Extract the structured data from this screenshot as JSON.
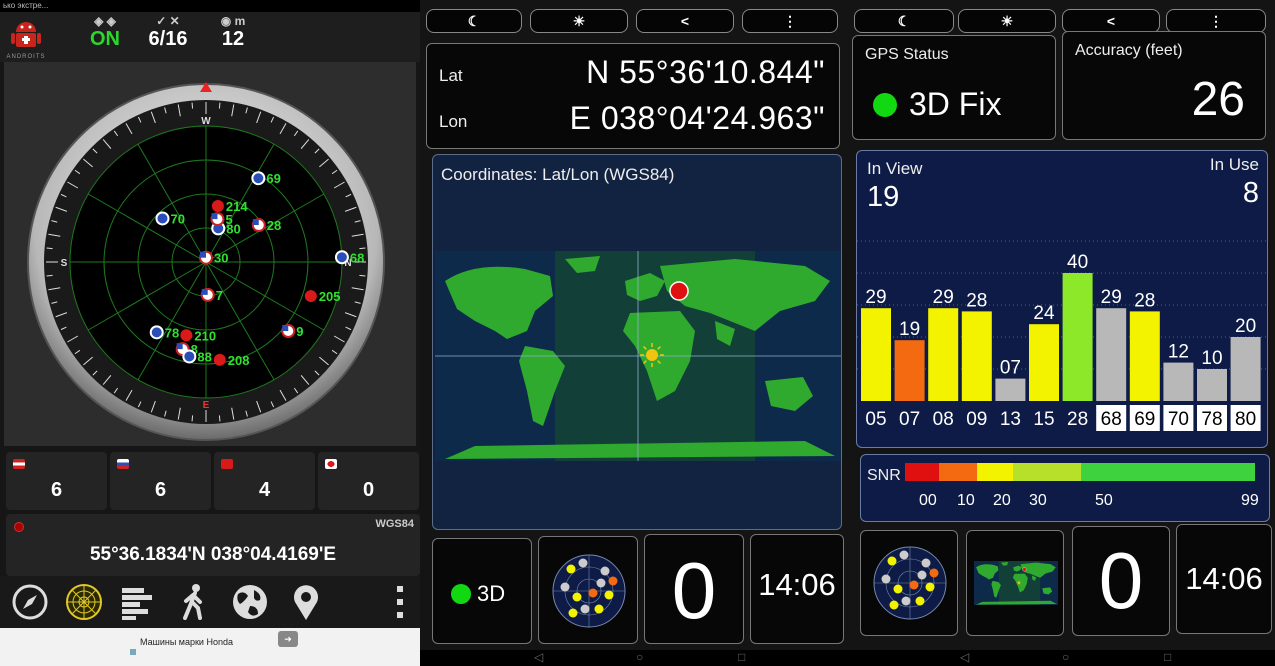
{
  "left_app": {
    "status_text": "ько экстре...",
    "logo_text": "ANDROITS",
    "status": {
      "fix_label": "ON",
      "sats_label": "6/16",
      "accuracy_unit": "m",
      "accuracy_value": "12"
    },
    "compass": {
      "bearings": [
        "W",
        "N",
        "E",
        "S"
      ],
      "sats": [
        {
          "id": "80",
          "az": 20,
          "el": 70,
          "flag": "ru"
        },
        {
          "id": "5",
          "az": 15,
          "el": 64,
          "flag": "us"
        },
        {
          "id": "214",
          "az": 12,
          "el": 55,
          "flag": "cn"
        },
        {
          "id": "70",
          "az": 315,
          "el": 52,
          "flag": "ru"
        },
        {
          "id": "69",
          "az": 32,
          "el": 26,
          "flag": "ru"
        },
        {
          "id": "28",
          "az": 55,
          "el": 50,
          "flag": "us"
        },
        {
          "id": "68",
          "az": 88,
          "el": 0,
          "flag": "ru"
        },
        {
          "id": "30",
          "az": 0,
          "el": 92,
          "flag": "us"
        },
        {
          "id": "205",
          "az": 108,
          "el": 18,
          "flag": "cn"
        },
        {
          "id": "7",
          "az": 177,
          "el": 72,
          "flag": "us"
        },
        {
          "id": "9",
          "az": 130,
          "el": 20,
          "flag": "us"
        },
        {
          "id": "78",
          "az": 215,
          "el": 35,
          "flag": "ru"
        },
        {
          "id": "210",
          "az": 195,
          "el": 42,
          "flag": "cn"
        },
        {
          "id": "8",
          "az": 195,
          "el": 32,
          "flag": "us"
        },
        {
          "id": "88",
          "az": 190,
          "el": 28,
          "flag": "ru"
        },
        {
          "id": "208",
          "az": 172,
          "el": 26,
          "flag": "cn"
        }
      ]
    },
    "counts": [
      {
        "flag": "us",
        "value": "6"
      },
      {
        "flag": "ru",
        "value": "6"
      },
      {
        "flag": "cn",
        "value": "4"
      },
      {
        "flag": "jp",
        "value": "0"
      }
    ],
    "coords_text": "55°36.1834'N  038°04.4169'E",
    "datum": "WGS84",
    "toolbar": [
      "compass-icon",
      "radar-icon",
      "signal-bars-icon",
      "walking-icon",
      "globe-icon",
      "location-pin-icon",
      "more-icon"
    ],
    "ad_text": "Машины марки Honda"
  },
  "gps_test_1": {
    "toolbar": [
      "moon-icon",
      "sun-icon",
      "share-icon",
      "more-icon"
    ],
    "lat_label": "Lat",
    "lat_value": "N   55°36'10.844\"",
    "lon_label": "Lon",
    "lon_value": "E 038°04'24.963\"",
    "map_title": "Coordinates: Lat/Lon (WGS84)",
    "tiles": {
      "fix": "3D",
      "sats_in_use": "0",
      "time": "14:06"
    }
  },
  "gps_test_2": {
    "toolbar": [
      "moon-icon",
      "sun-icon",
      "share-icon",
      "more-icon"
    ],
    "gps_status_label": "GPS Status",
    "gps_status_value": "3D Fix",
    "accuracy_label": "Accuracy (feet)",
    "accuracy_value": "26",
    "in_view_label": "In View",
    "in_view_value": "19",
    "in_use_label": "In Use",
    "in_use_value": "8",
    "snr_label": "SNR",
    "snr_ticks": [
      "00",
      "10",
      "20",
      "30",
      "50",
      "99"
    ],
    "tiles": {
      "sats_in_use": "0",
      "time": "14:06"
    },
    "colors": {
      "yellow": "#f3f300",
      "orange": "#f36a10",
      "green": "#8ee82a",
      "gray": "#b8b8b8"
    }
  },
  "chart_data": {
    "type": "bar",
    "title": "",
    "categories": [
      "05",
      "07",
      "08",
      "09",
      "13",
      "15",
      "28",
      "68",
      "69",
      "70",
      "78",
      "80"
    ],
    "values": [
      29,
      19,
      29,
      28,
      7,
      24,
      40,
      29,
      28,
      12,
      10,
      20
    ],
    "value_labels": [
      "29",
      "19",
      "29",
      "28",
      "07",
      "24",
      "40",
      "29",
      "28",
      "12",
      "10",
      "20"
    ],
    "in_use": [
      false,
      false,
      false,
      false,
      false,
      false,
      false,
      true,
      true,
      true,
      true,
      true
    ],
    "bar_colors": [
      "#f3f300",
      "#f36a10",
      "#f3f300",
      "#f3f300",
      "#b8b8b8",
      "#f3f300",
      "#8ee82a",
      "#b8b8b8",
      "#f3f300",
      "#b8b8b8",
      "#b8b8b8",
      "#b8b8b8"
    ],
    "ylim": [
      0,
      50
    ],
    "grid": true
  }
}
